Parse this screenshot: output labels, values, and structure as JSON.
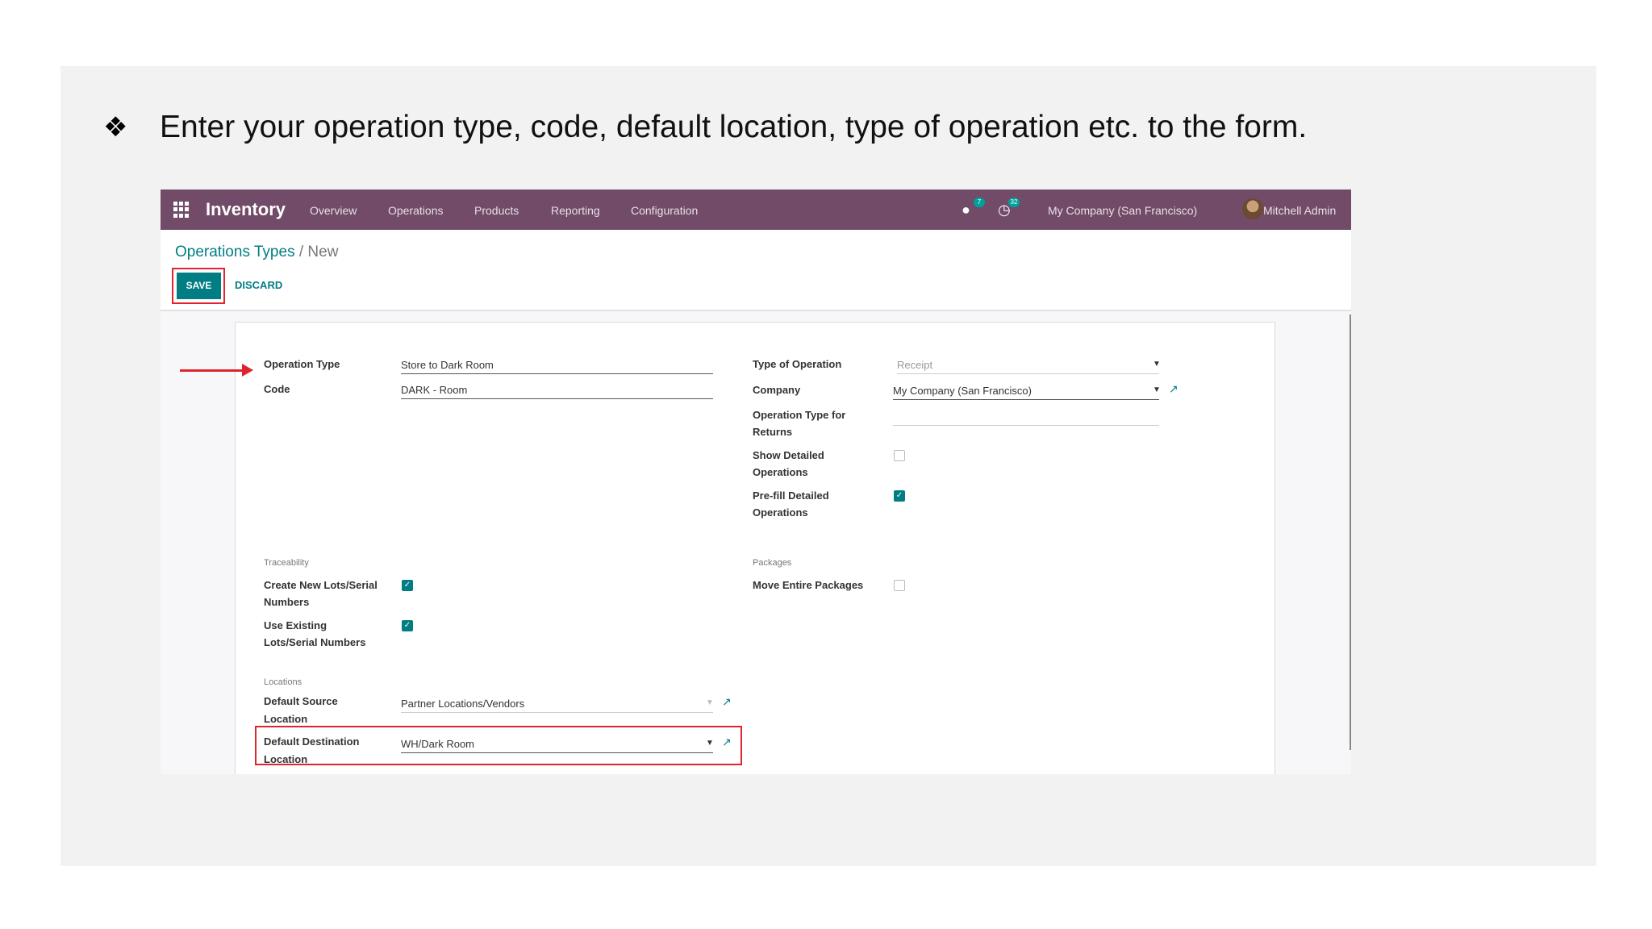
{
  "slide": {
    "bullet_glyph": "❖",
    "heading": "Enter your operation type, code, default location, type of operation etc. to the form."
  },
  "navbar": {
    "app_name": "Inventory",
    "menu": [
      "Overview",
      "Operations",
      "Products",
      "Reporting",
      "Configuration"
    ],
    "messages_badge": "7",
    "activities_badge": "32",
    "company": "My Company (San Francisco)",
    "user": "Mitchell Admin"
  },
  "control_panel": {
    "breadcrumb_parent": "Operations Types",
    "breadcrumb_separator": "/",
    "breadcrumb_current": "New",
    "save_label": "SAVE",
    "discard_label": "DISCARD"
  },
  "form": {
    "operation_type_label": "Operation Type",
    "operation_type_value": "Store to Dark Room",
    "code_label": "Code",
    "code_value": "DARK - Room",
    "type_of_operation_label": "Type of Operation",
    "type_of_operation_value": "Receipt",
    "company_label": "Company",
    "company_value": "My Company (San Francisco)",
    "return_type_label_1": "Operation Type for",
    "return_type_label_2": "Returns",
    "show_detailed_label_1": "Show Detailed",
    "show_detailed_label_2": "Operations",
    "show_detailed_checked": false,
    "prefill_label_1": "Pre-fill Detailed",
    "prefill_label_2": "Operations",
    "prefill_checked": true,
    "traceability_section": "Traceability",
    "create_lots_label_1": "Create New Lots/Serial",
    "create_lots_label_2": "Numbers",
    "create_lots_checked": true,
    "use_existing_label_1": "Use Existing",
    "use_existing_label_2": "Lots/Serial Numbers",
    "use_existing_checked": true,
    "packages_section": "Packages",
    "move_packages_label": "Move Entire Packages",
    "move_packages_checked": false,
    "locations_section": "Locations",
    "default_source_label_1": "Default Source",
    "default_source_label_2": "Location",
    "default_source_value": "Partner Locations/Vendors",
    "default_dest_label_1": "Default Destination",
    "default_dest_label_2": "Location",
    "default_dest_value": "WH/Dark Room"
  },
  "colors": {
    "navbar": "#714b67",
    "accent": "#017e84",
    "highlight": "#e0242c"
  }
}
